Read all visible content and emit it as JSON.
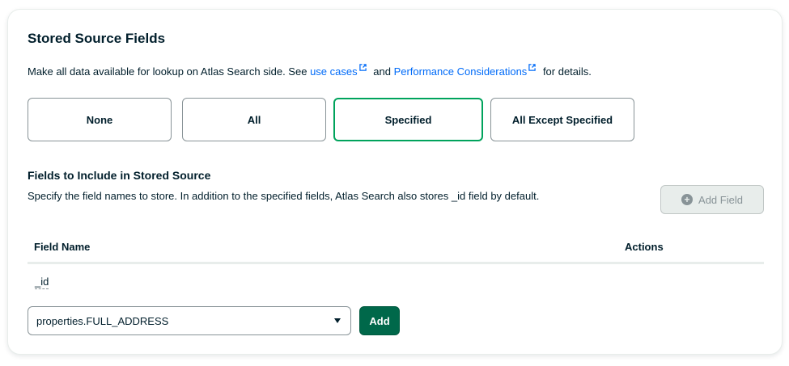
{
  "header": {
    "title": "Stored Source Fields",
    "desc_prefix": "Make all data available for lookup on Atlas Search side. See",
    "link_use_cases": "use cases",
    "desc_and": "and",
    "link_performance": "Performance Considerations",
    "desc_suffix": "for details."
  },
  "options": [
    {
      "label": "None"
    },
    {
      "label": "All"
    },
    {
      "label": "Specified"
    },
    {
      "label": "All Except Specified"
    }
  ],
  "selected_option": "Specified",
  "fields_section": {
    "title": "Fields to Include in Stored Source",
    "description": "Specify the field names to store. In addition to the specified fields, Atlas Search also stores _id field by default.",
    "add_field_label": "Add Field",
    "add_field_icon": "plus-circle-icon"
  },
  "table": {
    "columns": [
      "Field Name",
      "Actions"
    ],
    "rows": [
      {
        "field": "_id"
      }
    ]
  },
  "new_field": {
    "selected_value": "properties.FULL_ADDRESS",
    "add_label": "Add"
  },
  "colors": {
    "accent_green": "#00a35c",
    "button_green": "#00684a",
    "link_blue": "#016bf8",
    "text": "#001e2b"
  }
}
